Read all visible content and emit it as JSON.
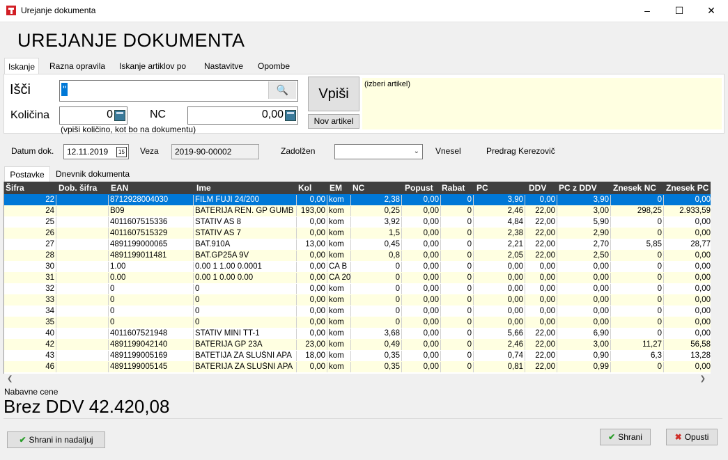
{
  "window": {
    "title": "Urejanje dokumenta",
    "controls": {
      "minimize": "–",
      "maximize": "☐",
      "close": "✕"
    }
  },
  "page_title": "UREJANJE DOKUMENTA",
  "tabs": [
    "Iskanje",
    "Razna opravila",
    "Iskanje artiklov po",
    "Nastavitve",
    "Opombe"
  ],
  "search": {
    "label": "Išči",
    "value": "''",
    "button_icon": "magnifier-icon"
  },
  "quantity": {
    "label": "Količina",
    "value": "0",
    "hint": "(vpiši količino, kot bo na dokumentu)"
  },
  "nc": {
    "label": "NC",
    "value": "0,00"
  },
  "buttons": {
    "vpisi": "Vpiši",
    "nov_artikel": "Nov artikel",
    "shrani_nadaljuj": "Shrani in nadaljuj",
    "shrani": "Shrani",
    "opusti": "Opusti"
  },
  "artikel_info": "(izberi artikel)",
  "document": {
    "datum_label": "Datum dok.",
    "datum_value": "12.11.2019",
    "veza_label": "Veza",
    "veza_value": "2019-90-00002",
    "zadolzen_label": "Zadolžen",
    "zadolzen_value": "",
    "vnesel_label": "Vnesel",
    "vnesel_value": "Predrag Kerezovič"
  },
  "sub_tabs": [
    "Postavke",
    "Dnevnik dokumenta"
  ],
  "grid": {
    "columns": [
      "Šifra",
      "Dob. šifra",
      "EAN",
      "Ime",
      "Kol",
      "EM",
      "NC",
      "Popust",
      "Rabat",
      "PC",
      "DDV",
      "PC z DDV",
      "Znesek NC",
      "Znesek PC"
    ],
    "rows": [
      [
        "22",
        "",
        "8712928004030",
        "FILM FUJI 24/200",
        "0,00",
        "kom",
        "2,38",
        "0,00",
        "0",
        "3,90",
        "0,00",
        "3,90",
        "0",
        "0,00"
      ],
      [
        "24",
        "",
        "B09",
        "BATERIJA REN. GP GUMB",
        "193,00",
        "kom",
        "0,25",
        "0,00",
        "0",
        "2,46",
        "22,00",
        "3,00",
        "298,25",
        "2.933,59"
      ],
      [
        "25",
        "",
        "4011607515336",
        "STATIV AS 8",
        "0,00",
        "kom",
        "3,92",
        "0,00",
        "0",
        "4,84",
        "22,00",
        "5,90",
        "0",
        "0,00"
      ],
      [
        "26",
        "",
        "4011607515329",
        "STATIV AS 7",
        "0,00",
        "kom",
        "1,5",
        "0,00",
        "0",
        "2,38",
        "22,00",
        "2,90",
        "0",
        "0,00"
      ],
      [
        "27",
        "",
        "4891199000065",
        "BAT.910A",
        "13,00",
        "kom",
        "0,45",
        "0,00",
        "0",
        "2,21",
        "22,00",
        "2,70",
        "5,85",
        "28,77"
      ],
      [
        "28",
        "",
        "4891199011481",
        "BAT.GP25A 9V",
        "0,00",
        "kom",
        "0,8",
        "0,00",
        "0",
        "2,05",
        "22,00",
        "2,50",
        "0",
        "0,00"
      ],
      [
        "30",
        "",
        "1.00",
        "0.00 1      1.00      0.0001",
        "0,00",
        "CA B",
        "0",
        "0,00",
        "0",
        "0,00",
        "0,00",
        "0,00",
        "0",
        "0,00"
      ],
      [
        "31",
        "",
        "0.00",
        "0.00 1      0.00      0.00",
        "0,00",
        "CA 20",
        "0",
        "0,00",
        "0",
        "0,00",
        "0,00",
        "0,00",
        "0",
        "0,00"
      ],
      [
        "32",
        "",
        "0",
        "0",
        "0,00",
        "kom",
        "0",
        "0,00",
        "0",
        "0,00",
        "0,00",
        "0,00",
        "0",
        "0,00"
      ],
      [
        "33",
        "",
        "0",
        "0",
        "0,00",
        "kom",
        "0",
        "0,00",
        "0",
        "0,00",
        "0,00",
        "0,00",
        "0",
        "0,00"
      ],
      [
        "34",
        "",
        "0",
        "0",
        "0,00",
        "kom",
        "0",
        "0,00",
        "0",
        "0,00",
        "0,00",
        "0,00",
        "0",
        "0,00"
      ],
      [
        "35",
        "",
        "0",
        "0",
        "0,00",
        "kom",
        "0",
        "0,00",
        "0",
        "0,00",
        "0,00",
        "0,00",
        "0",
        "0,00"
      ],
      [
        "40",
        "",
        "4011607521948",
        "STATIV MINI TT-1",
        "0,00",
        "kom",
        "3,68",
        "0,00",
        "0",
        "5,66",
        "22,00",
        "6,90",
        "0",
        "0,00"
      ],
      [
        "42",
        "",
        "4891199042140",
        "BATERIJA GP 23A",
        "23,00",
        "kom",
        "0,49",
        "0,00",
        "0",
        "2,46",
        "22,00",
        "3,00",
        "11,27",
        "56,58"
      ],
      [
        "43",
        "",
        "4891199005169",
        "BATETIJA ZA SLUŠNI APA",
        "18,00",
        "kom",
        "0,35",
        "0,00",
        "0",
        "0,74",
        "22,00",
        "0,90",
        "6,3",
        "13,28"
      ],
      [
        "46",
        "",
        "4891199005145",
        "BATERIJA ZA SLUŠNI APA",
        "0,00",
        "kom",
        "0,35",
        "0,00",
        "0",
        "0,81",
        "22,00",
        "0,99",
        "0",
        "0,00"
      ]
    ]
  },
  "totals": {
    "caption": "Nabavne cene",
    "value": "Brez DDV 42.420,08"
  }
}
